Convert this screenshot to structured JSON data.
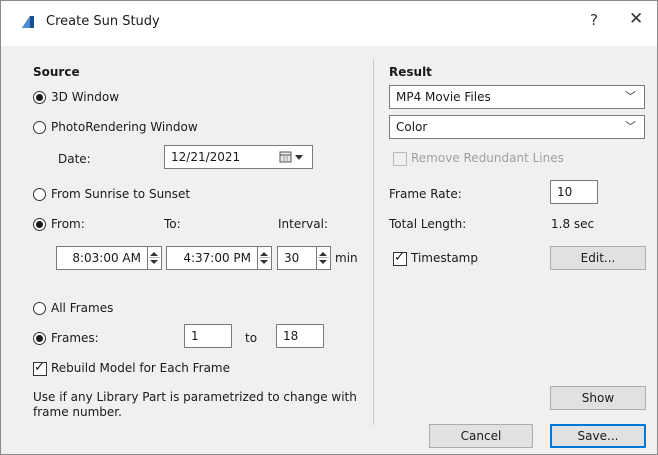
{
  "window": {
    "title": "Create Sun Study",
    "help_label": "?",
    "close_label": "✕"
  },
  "source": {
    "title": "Source",
    "window_3d": "3D Window",
    "photorendering": "PhotoRendering Window",
    "date_label": "Date:",
    "date_value": "12/21/2021",
    "sunrise_sunset": "From Sunrise to Sunset",
    "from_label": "From:",
    "to_label": "To:",
    "interval_label": "Interval:",
    "from_value": "8:03:00 AM",
    "to_value": "4:37:00 PM",
    "interval_value": "30",
    "interval_unit": "min",
    "all_frames": "All Frames",
    "frames_label": "Frames:",
    "frames_from": "1",
    "frames_to_label": "to",
    "frames_to": "18",
    "rebuild_label": "Rebuild Model for Each Frame",
    "rebuild_checked": true,
    "note_line1": "Use if any Library Part is parametrized to change with",
    "note_line2": "frame number.",
    "selected_window": "3D Window",
    "selected_time": "From",
    "selected_frames": "Frames"
  },
  "result": {
    "title": "Result",
    "format_value": "MP4 Movie Files",
    "color_value": "Color",
    "remove_lines_label": "Remove Redundant Lines",
    "remove_lines_checked": false,
    "frame_rate_label": "Frame Rate:",
    "frame_rate_value": "10",
    "total_length_label": "Total Length:",
    "total_length_value": "1.8 sec",
    "timestamp_label": "Timestamp",
    "timestamp_checked": true,
    "edit_label": "Edit...",
    "show_label": "Show"
  },
  "footer": {
    "cancel_label": "Cancel",
    "save_label": "Save..."
  },
  "colors": {
    "accent": "#0078d7",
    "icon_blue": "#1f4e8c"
  }
}
